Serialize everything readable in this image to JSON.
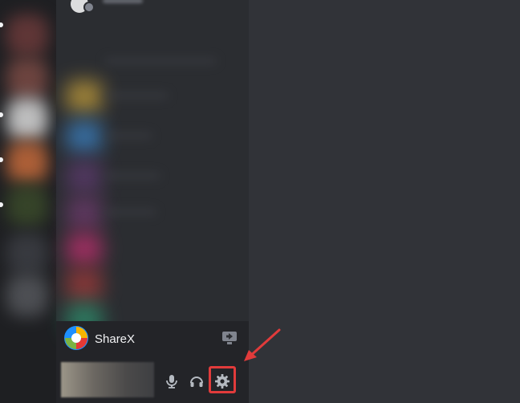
{
  "current_app": {
    "name": "ShareX",
    "logo_icon": "sharex-logo-icon",
    "action_icon": "screen-share-icon"
  },
  "user_controls": {
    "mute_icon": "microphone-icon",
    "deafen_icon": "headphones-icon",
    "settings_icon": "gear-icon"
  },
  "annotation": {
    "highlight_color": "#e13b3b",
    "arrow_color": "#e13b3b"
  },
  "colors": {
    "background": "#313338",
    "server_rail": "#1e1f22",
    "channel_panel": "#2b2d31",
    "user_panel": "#232428",
    "text": "#f2f3f5",
    "icon": "#b5bac1"
  }
}
